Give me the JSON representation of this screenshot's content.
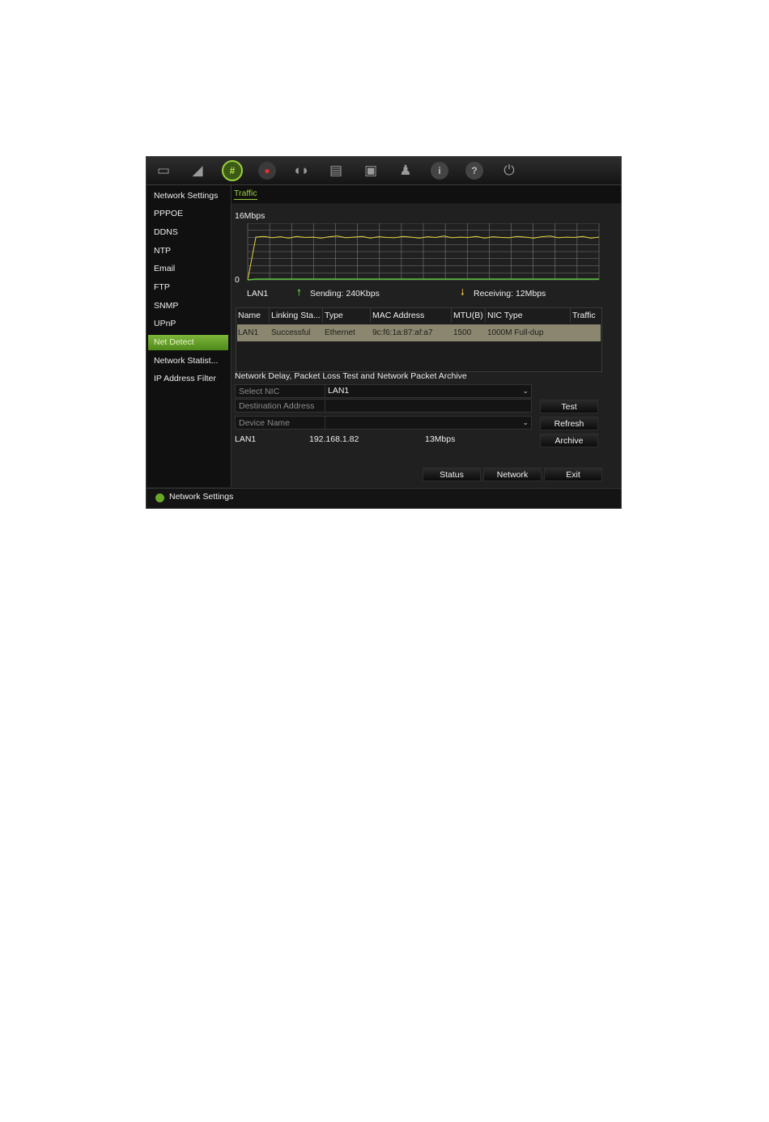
{
  "toolbar": {
    "icons": [
      "display-icon",
      "camera-icon",
      "network-icon",
      "record-icon",
      "alarm-icon",
      "device-icon",
      "storage-icon",
      "user-icon",
      "info-icon",
      "help-icon",
      "power-icon"
    ],
    "active": "network-icon"
  },
  "sidebar": {
    "items": [
      {
        "label": "Network Settings"
      },
      {
        "label": "PPPOE"
      },
      {
        "label": "DDNS"
      },
      {
        "label": "NTP"
      },
      {
        "label": "Email"
      },
      {
        "label": "FTP"
      },
      {
        "label": "SNMP"
      },
      {
        "label": "UPnP"
      },
      {
        "label": "Net Detect"
      },
      {
        "label": "Network Statist..."
      },
      {
        "label": "IP Address Filter"
      }
    ],
    "active_index": 8
  },
  "tabs": {
    "traffic": "Traffic"
  },
  "traffic": {
    "y_max_label": "16Mbps",
    "y_min_label": "0",
    "interface": "LAN1",
    "sending": "Sending: 240Kbps",
    "receiving": "Receiving: 12Mbps"
  },
  "chart_data": {
    "type": "line",
    "ylim": [
      0,
      16
    ],
    "series": [
      {
        "values": [
          0,
          12.1,
          12.3,
          11.9,
          12.2,
          11.8,
          12.3,
          12.0,
          12.1,
          11.8,
          12.2,
          12.4,
          11.9,
          12.1,
          12.3,
          11.8,
          12.2,
          12.0,
          11.9,
          12.3,
          12.1,
          11.8,
          12.2,
          12.0,
          12.4,
          11.9,
          12.1,
          12.0,
          12.3,
          11.8,
          12.2,
          12.0,
          11.9,
          12.3,
          12.1,
          11.8,
          12.2,
          12.4,
          11.9,
          12.1,
          12.0,
          12.3,
          11.8,
          12.1
        ]
      },
      {
        "values": [
          0,
          0.24,
          0.24,
          0.24,
          0.24,
          0.24,
          0.24,
          0.24,
          0.24,
          0.24,
          0.24,
          0.24,
          0.24,
          0.24,
          0.24,
          0.24,
          0.24,
          0.24,
          0.24,
          0.24,
          0.24,
          0.24,
          0.24,
          0.24,
          0.24,
          0.24,
          0.24,
          0.24,
          0.24,
          0.24,
          0.24,
          0.24,
          0.24,
          0.24,
          0.24,
          0.24,
          0.24,
          0.24,
          0.24,
          0.24,
          0.24,
          0.24,
          0.24,
          0.24
        ]
      }
    ],
    "colors": {
      "receive": "#e4d23c",
      "send": "#5cc43a",
      "grid": "#7a7a7a"
    }
  },
  "table": {
    "columns": [
      "Name",
      "Linking Sta...",
      "Type",
      "MAC Address",
      "MTU(B)",
      "NIC Type",
      "Traffic"
    ],
    "rows": [
      [
        "LAN1",
        "Successful",
        "Ethernet",
        "9c:f6:1a:87:af:a7",
        "1500",
        "1000M Full-dup",
        ""
      ]
    ]
  },
  "test": {
    "heading": "Network Delay, Packet Loss Test and Network Packet Archive",
    "select_nic_label": "Select NIC",
    "select_nic_value": "LAN1",
    "destination_label": "Destination Address",
    "destination_value": "",
    "device_label": "Device Name",
    "device_value": "",
    "result_nic": "LAN1",
    "result_ip": "192.168.1.82",
    "result_speed": "13Mbps",
    "test_btn": "Test",
    "refresh_btn": "Refresh",
    "archive_btn": "Archive"
  },
  "footer_buttons": {
    "status": "Status",
    "network": "Network",
    "exit": "Exit"
  },
  "statusbar": {
    "text": "Network Settings"
  }
}
